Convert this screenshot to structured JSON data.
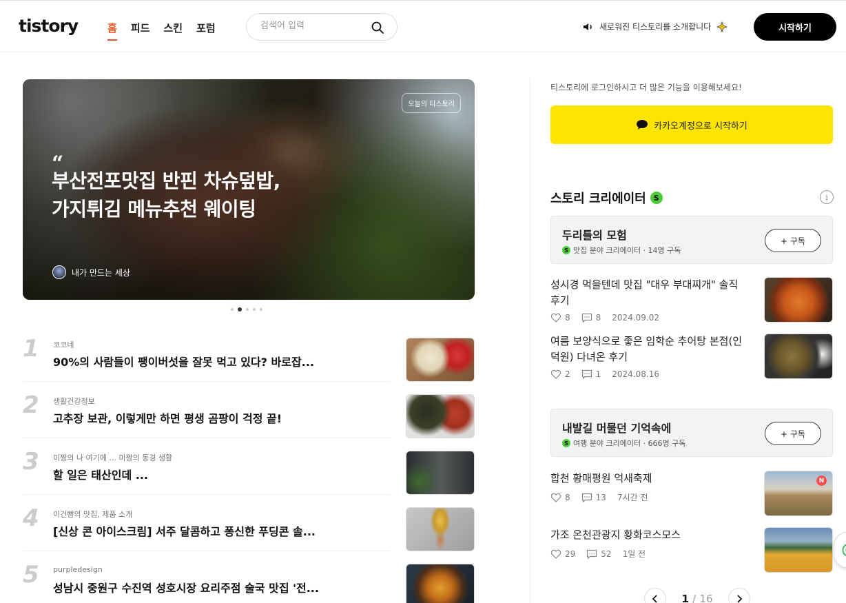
{
  "header": {
    "logo": "tistory",
    "nav": [
      "홈",
      "피드",
      "스킨",
      "포럼"
    ],
    "search_placeholder": "검색어 입력",
    "announcement": "새로워진 티스토리를 소개합니다",
    "start_button": "시작하기"
  },
  "hero": {
    "badge": "오늘의 티스토리",
    "quote_mark": "“",
    "title": "부산전포맛집 반핀 차슈덮밥, 가지튀김 메뉴추천 웨이팅",
    "author": "내가 만드는 세상",
    "slide_count": 5,
    "active_slide": 2
  },
  "ranking": [
    {
      "num": "1",
      "category": "코코네",
      "title": "90%의 사람들이 팽이버섯을 잘못 먹고 있다? 바로잡..."
    },
    {
      "num": "2",
      "category": "생활건강정보",
      "title": "고추장 보관, 이렇게만 하면 평생 곰팡이 걱정 끝!"
    },
    {
      "num": "3",
      "category": "미짱의 나 여기에 ... 미짱의 동경 생활",
      "title": "할 일은 태산인데 ..."
    },
    {
      "num": "4",
      "category": "이건빵의 맛집, 제품 소개",
      "title": "[신상 콘 아이스크림] 서주 달콤하고 퐁신한 푸딩콘 솔..."
    },
    {
      "num": "5",
      "category": "purpledesign",
      "title": "성남시 중원구 수진역 성호시장 요리주점 술국 맛집 '전..."
    }
  ],
  "sidebar": {
    "login_message": "티스토리에 로그인하시고 더 많은 기능을 이용해보세요!",
    "kakao_button": "카카오계정으로 시작하기",
    "creator_heading": "스토리 크리에이터",
    "s_badge": "S",
    "info": "i",
    "subscribe_label": "+ 구독",
    "creators": [
      {
        "name": "두리틀의 모험",
        "meta": "맛집 분야 크리에이터 · 14명 구독",
        "posts": [
          {
            "title": "성시경 먹을텐데 맛집 \"대우 부대찌개\" 솔직 후기",
            "likes": "8",
            "comments": "8",
            "date": "2024.09.02"
          },
          {
            "title": "여름 보양식으로 좋은 임학순 추어탕 본점(인덕원) 다녀온 후기",
            "likes": "2",
            "comments": "1",
            "date": "2024.08.16"
          }
        ]
      },
      {
        "name": "내발길 머물던 기억속에",
        "meta": "여행 분야 크리에이터 · 666명 구독",
        "posts": [
          {
            "title": "합천 황매평원 억새축제",
            "likes": "8",
            "comments": "13",
            "date": "7시간 전",
            "badge": "N"
          },
          {
            "title": "가조 온천관광지 황화코스모스",
            "likes": "29",
            "comments": "52",
            "date": "1일 전"
          }
        ]
      }
    ],
    "pager": {
      "current": "1",
      "total": "16",
      "separator": "/"
    }
  },
  "colors": {
    "accent": "#eb531f",
    "kakao": "#fee500",
    "creator_badge": "#4fca3b",
    "new_badge": "#ff4d4d"
  },
  "icons": {
    "search": "search-icon",
    "announce": "speaker-icon",
    "kakao": "chat-bubble-icon",
    "like": "heart-icon",
    "comment": "comment-icon",
    "info": "info-icon",
    "prev": "chevron-left-icon",
    "next": "chevron-right-icon"
  }
}
